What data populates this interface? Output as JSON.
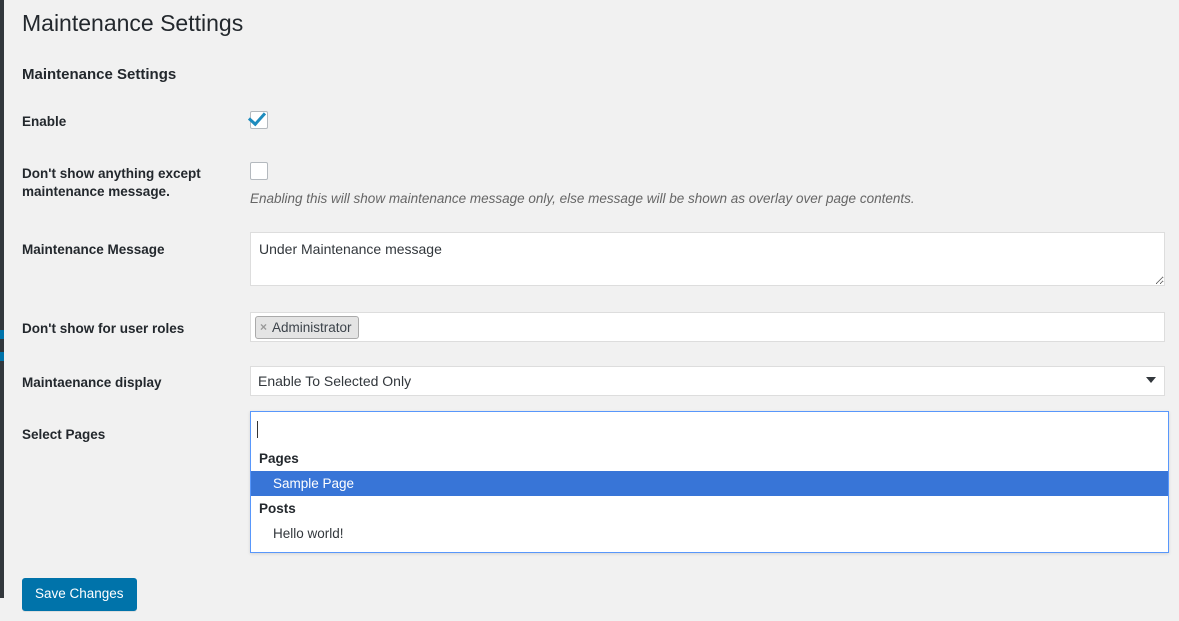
{
  "page": {
    "title": "Maintenance Settings",
    "section_title": "Maintenance Settings"
  },
  "colors": {
    "accent_blue": "#0073aa",
    "highlight_blue": "#3875d7",
    "focus_border": "#5897fb",
    "admin_menu_dark": "#32373c",
    "page_background": "#f1f1f1"
  },
  "form": {
    "enable": {
      "label": "Enable",
      "checked": true
    },
    "only_message": {
      "label": "Don't show anything except maintenance message.",
      "checked": false,
      "description": "Enabling this will show maintenance message only, else message will be shown as overlay over page contents."
    },
    "maintenance_message": {
      "label": "Maintenance Message",
      "value": "Under Maintenance message",
      "placeholder": ""
    },
    "user_roles": {
      "label": "Don't show for user roles",
      "tags": [
        {
          "remove_glyph": "×",
          "text": "Administrator"
        }
      ]
    },
    "display_mode": {
      "label": "Maintaenance display",
      "selected": "Enable To Selected Only",
      "arrow_glyph": "▼"
    },
    "select_pages": {
      "label": "Select Pages",
      "search_value": "",
      "groups": [
        {
          "group_label": "Pages",
          "options": [
            {
              "text": "Sample Page",
              "highlighted": true
            }
          ]
        },
        {
          "group_label": "Posts",
          "options": [
            {
              "text": "Hello world!",
              "highlighted": false
            }
          ]
        }
      ]
    }
  },
  "actions": {
    "save_label": "Save Changes"
  }
}
